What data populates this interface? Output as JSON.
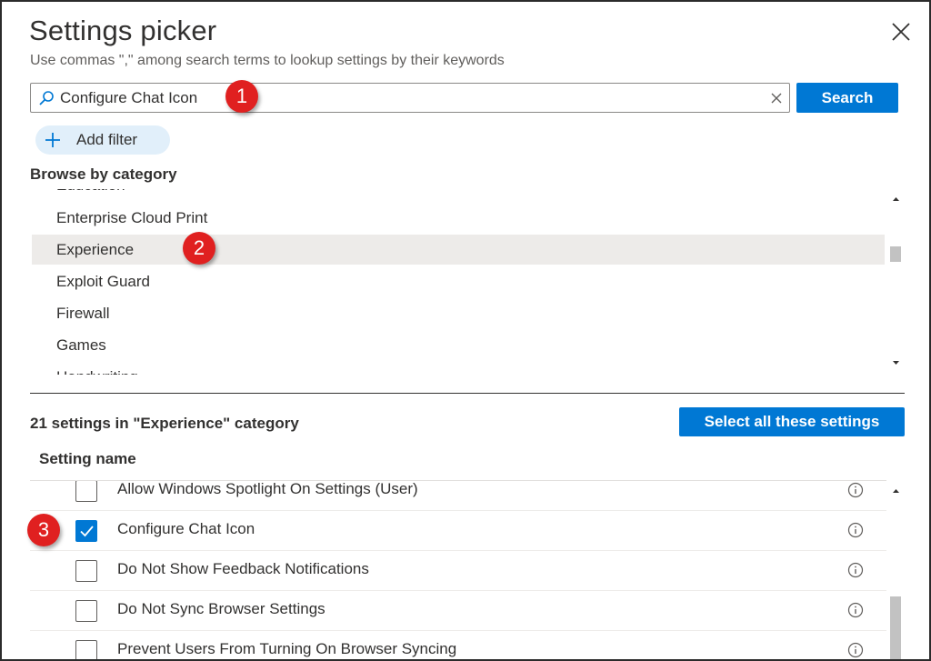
{
  "dialog": {
    "title": "Settings picker",
    "subtitle": "Use commas \",\" among search terms to lookup settings by their keywords"
  },
  "search": {
    "value": "Configure Chat Icon",
    "button_label": "Search"
  },
  "filter": {
    "add_label": "Add filter"
  },
  "browse": {
    "label": "Browse by category",
    "categories": [
      {
        "label": "Education",
        "selected": false
      },
      {
        "label": "Enterprise Cloud Print",
        "selected": false
      },
      {
        "label": "Experience",
        "selected": true
      },
      {
        "label": "Exploit Guard",
        "selected": false
      },
      {
        "label": "Firewall",
        "selected": false
      },
      {
        "label": "Games",
        "selected": false
      },
      {
        "label": "Handwriting",
        "selected": false
      }
    ]
  },
  "results": {
    "count_label": "21 settings in \"Experience\" category",
    "select_all_label": "Select all these settings",
    "column_header": "Setting name",
    "settings": [
      {
        "name": "Allow Windows Spotlight On Settings (User)",
        "checked": false
      },
      {
        "name": "Configure Chat Icon",
        "checked": true
      },
      {
        "name": "Do Not Show Feedback Notifications",
        "checked": false
      },
      {
        "name": "Do Not Sync Browser Settings",
        "checked": false
      },
      {
        "name": "Prevent Users From Turning On Browser Syncing",
        "checked": false
      }
    ]
  },
  "annotations": {
    "step1": "1",
    "step2": "2",
    "step3": "3"
  },
  "colors": {
    "accent": "#0078d4",
    "badge": "#e02020",
    "selected_row": "#edebe9",
    "filter_pill": "#e1effa"
  }
}
